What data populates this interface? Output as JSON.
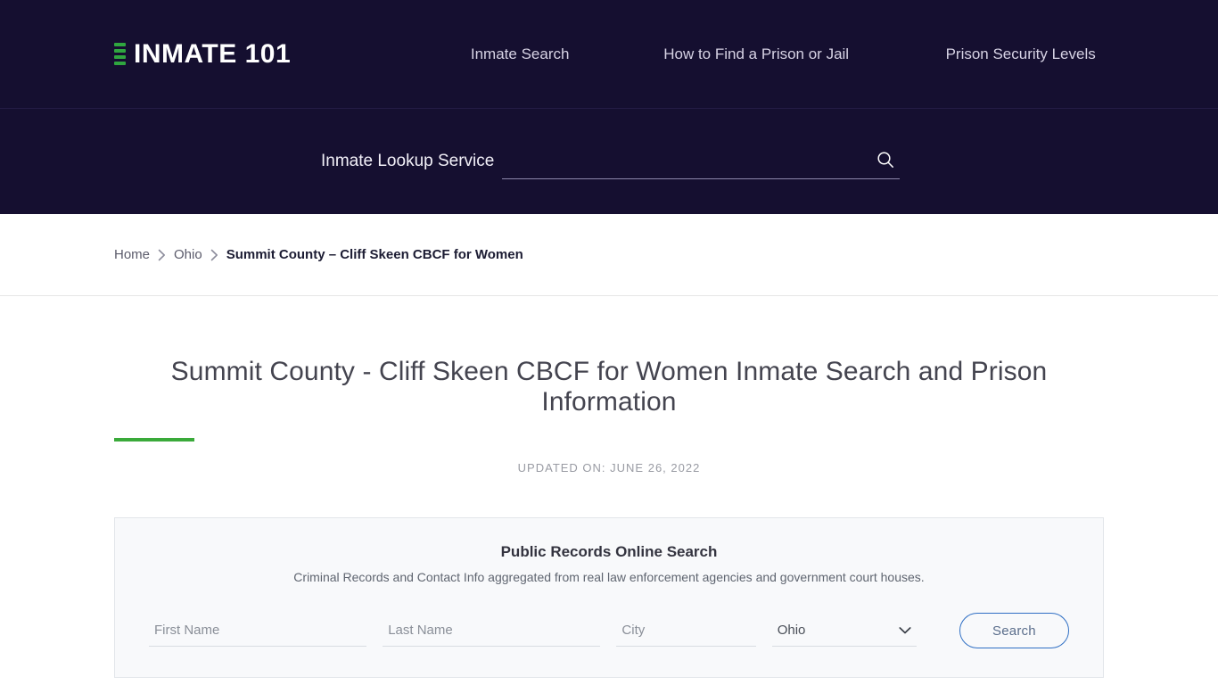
{
  "header": {
    "brand": {
      "text": "INMATE 101",
      "mark_color": "#2fa63f"
    },
    "nav": [
      {
        "label": "Inmate Search"
      },
      {
        "label": "How to Find a Prison or Jail"
      },
      {
        "label": "Prison Security Levels"
      }
    ],
    "search": {
      "label": "Inmate Lookup Service",
      "value": "",
      "placeholder": ""
    }
  },
  "breadcrumb": {
    "items": [
      {
        "label": "Home",
        "current": false
      },
      {
        "label": "Ohio",
        "current": false
      },
      {
        "label": "Summit County – Cliff Skeen CBCF for Women",
        "current": true
      }
    ]
  },
  "main": {
    "title": "Summit County - Cliff Skeen CBCF for Women Inmate Search and Prison Information",
    "accent_color": "#3aaa3a",
    "updated_on": "UPDATED ON: JUNE 26, 2022"
  },
  "records_panel": {
    "heading": "Public Records Online Search",
    "subtitle": "Criminal Records and Contact Info aggregated from real law enforcement agencies and government court houses.",
    "form": {
      "first_name": {
        "value": "",
        "placeholder": "First Name"
      },
      "last_name": {
        "value": "",
        "placeholder": "Last Name"
      },
      "city": {
        "value": "",
        "placeholder": "City"
      },
      "state": {
        "selected": "Ohio"
      },
      "submit_label": "Search"
    }
  }
}
